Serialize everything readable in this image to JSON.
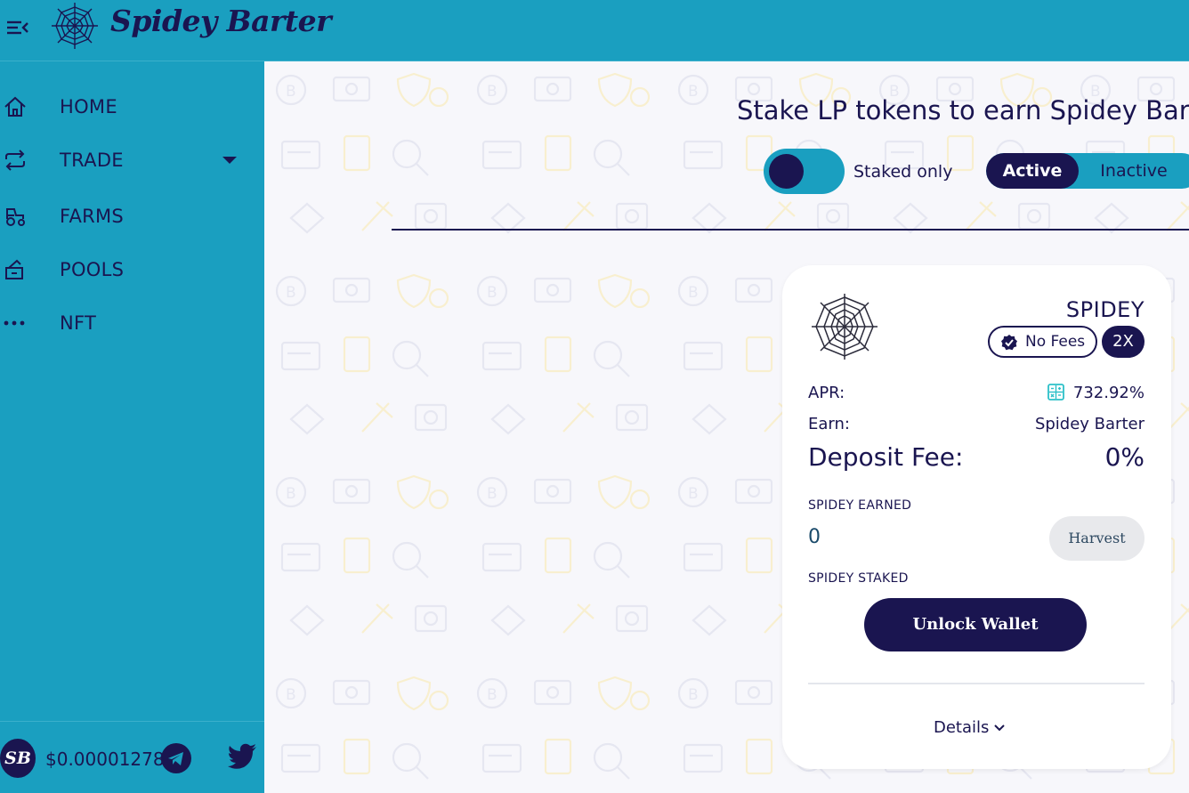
{
  "header": {
    "brand": "Spidey Barter"
  },
  "sidebar": {
    "items": [
      {
        "label": "HOME",
        "icon": "home-icon"
      },
      {
        "label": "TRADE",
        "icon": "swap-arrows-icon"
      },
      {
        "label": "FARMS",
        "icon": "tractor-icon"
      },
      {
        "label": "POOLS",
        "icon": "pool-icon"
      },
      {
        "label": "NFT",
        "icon": "more-dots-icon"
      }
    ],
    "footer": {
      "avatar": "SB",
      "price": "$0.00001278"
    }
  },
  "main": {
    "title": "Stake LP tokens to earn Spidey Barter",
    "staked_only_label": "Staked only",
    "staked_only_enabled": true,
    "tabs": {
      "active": "Active",
      "inactive": "Inactive"
    }
  },
  "card": {
    "token": "SPIDEY",
    "no_fees_label": "No Fees",
    "multiplier": "2X",
    "apr_label": "APR:",
    "apr_value": "732.92%",
    "earn_label": "Earn:",
    "earn_value": "Spidey Barter",
    "deposit_fee_label": "Deposit Fee:",
    "deposit_fee_value": "0%",
    "earned_label": "SPIDEY EARNED",
    "earned_value": "0",
    "harvest_label": "Harvest",
    "staked_label": "SPIDEY STAKED",
    "unlock_label": "Unlock Wallet",
    "details_label": "Details"
  },
  "colors": {
    "accent": "#1a9fc0",
    "navy": "#1a1550",
    "card": "#ffffff"
  }
}
